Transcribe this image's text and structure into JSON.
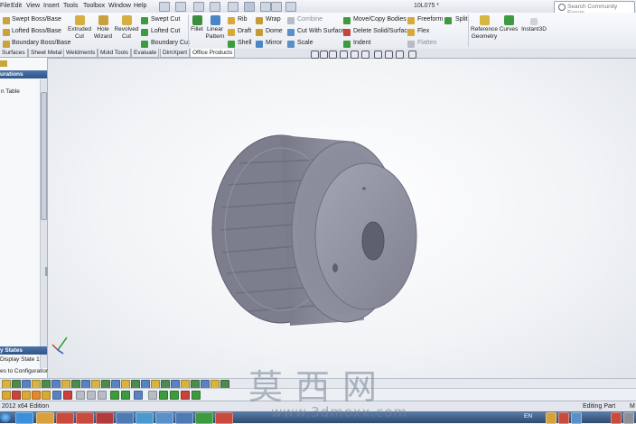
{
  "menubar": {
    "items": [
      "File",
      "Edit",
      "View",
      "Insert",
      "Tools",
      "Toolbox",
      "Window",
      "Help"
    ],
    "document_title": "10L075 *",
    "search_placeholder": "Search Community Forum"
  },
  "ribbon": {
    "boss_group": [
      "Swept Boss/Base",
      "Lofted Boss/Base",
      "Boundary Boss/Base"
    ],
    "extruded_cut": "Extruded\nCut",
    "hole_wizard": "Hole\nWizard",
    "revolved_cut": "Revolved\nCut",
    "cut_group": [
      "Swept Cut",
      "Lofted Cut",
      "Boundary Cut"
    ],
    "fillet": "Fillet",
    "linear_pattern": "Linear\nPattern",
    "features_col1": [
      "Rib",
      "Draft",
      "Shell"
    ],
    "features_col2": [
      "Wrap",
      "Dome",
      "Mirror"
    ],
    "features_col3": [
      "Combine",
      "Cut With Surface",
      "Scale"
    ],
    "features_col4": [
      "Move/Copy Bodies",
      "Delete Solid/Surface",
      "Indent"
    ],
    "features_col5": [
      "Freeform",
      "Flex",
      "Flatten"
    ],
    "split": "Split",
    "reference_geometry": "Reference\nGeometry",
    "curves": "Curves",
    "instant3d": "Instant3D"
  },
  "tabs": [
    "Surfaces",
    "Sheet Metal",
    "Weldments",
    "Mold Tools",
    "Evaluate",
    "DimXpert",
    "Office Products"
  ],
  "left_panel": {
    "header_top": "urations",
    "item_top": "n Table",
    "header_bottom": "y States",
    "display_state": "Display State 1",
    "link": "es to Configuration"
  },
  "status": {
    "edition": "2012 x64 Edition",
    "mode": "Editing Part",
    "units": "M"
  },
  "taskbar": {
    "lang": "EN"
  },
  "watermark": {
    "chars": "莫西网",
    "url": "www.3dmoxx.com"
  },
  "colors": {
    "part_body": "#8b8d9c",
    "viewport_bg": "#f1f3f6",
    "panel_header": "#3a6095"
  }
}
